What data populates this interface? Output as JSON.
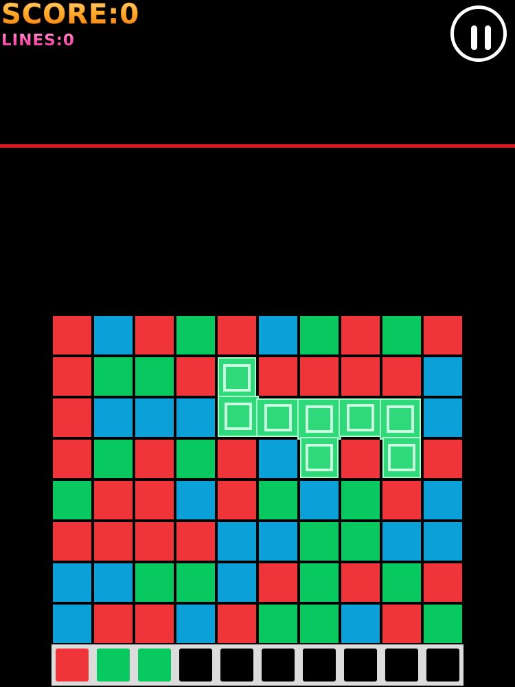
{
  "hud": {
    "score_text": "SCORE:0",
    "lines_text": "LINES:0"
  },
  "pause_button": {
    "icon": "pause-icon"
  },
  "colors": {
    "red": "#f0353a",
    "blue": "#0ba0d8",
    "green": "#08c860",
    "highlight": "#2fd97a",
    "limit_line": "#e0161e",
    "score_gradient": "#ffab2e",
    "lines_gradient": "#ff58b0"
  },
  "board": {
    "columns": 10,
    "rows": 8,
    "grid": [
      [
        "red",
        "blue",
        "red",
        "green",
        "red",
        "blue",
        "green",
        "red",
        "green",
        "red"
      ],
      [
        "red",
        "green",
        "green",
        "red",
        "hl",
        "red",
        "red",
        "red",
        "red",
        "blue"
      ],
      [
        "red",
        "blue",
        "blue",
        "blue",
        "hl",
        "hl",
        "hl",
        "hl",
        "hl",
        "blue"
      ],
      [
        "red",
        "green",
        "red",
        "green",
        "red",
        "blue",
        "hl",
        "red",
        "hl",
        "red"
      ],
      [
        "green",
        "red",
        "red",
        "blue",
        "red",
        "green",
        "blue",
        "green",
        "red",
        "blue"
      ],
      [
        "red",
        "red",
        "red",
        "red",
        "blue",
        "blue",
        "green",
        "green",
        "blue",
        "blue"
      ],
      [
        "blue",
        "blue",
        "green",
        "green",
        "blue",
        "red",
        "green",
        "red",
        "green",
        "red"
      ],
      [
        "blue",
        "red",
        "red",
        "blue",
        "red",
        "green",
        "green",
        "blue",
        "red",
        "green"
      ]
    ]
  },
  "next_queue": [
    "red",
    "green",
    "green",
    "empty",
    "empty",
    "empty",
    "empty",
    "empty",
    "empty",
    "empty"
  ]
}
